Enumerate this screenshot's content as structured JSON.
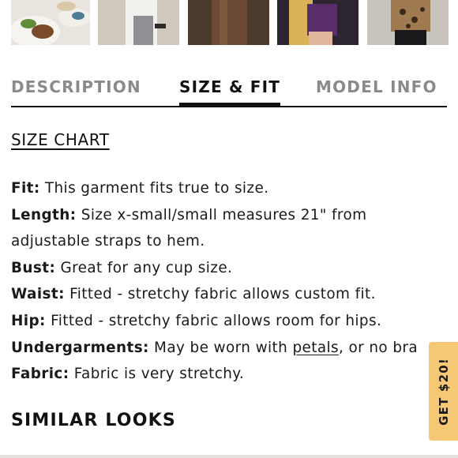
{
  "thumbnails": [
    {
      "name": "thumbnail-food-plate",
      "bg": "#e9e5de"
    },
    {
      "name": "thumbnail-model-white",
      "bg": "#d7d2cb"
    },
    {
      "name": "thumbnail-model-brown",
      "bg": "#5b4535"
    },
    {
      "name": "thumbnail-model-purple",
      "bg": "#3a2f3c"
    },
    {
      "name": "thumbnail-model-leopard",
      "bg": "#cfcac4"
    }
  ],
  "tabs": {
    "description": "DESCRIPTION",
    "size_fit": "SIZE & FIT",
    "model_info": "MODEL INFO",
    "active": "size_fit"
  },
  "size_chart_link": "SIZE CHART",
  "fit_details": {
    "fit": {
      "label": "Fit:",
      "text": " This garment fits true to size."
    },
    "length": {
      "label": "Length:",
      "text": " Size x-small/small measures 21\" from",
      "text2": "adjustable straps to hem."
    },
    "bust": {
      "label": "Bust:",
      "text": " Great for any cup size."
    },
    "waist": {
      "label": "Waist:",
      "text": " Fitted - stretchy fabric allows custom fit."
    },
    "hip": {
      "label": "Hip:",
      "text": " Fitted - stretchy fabric allows room for hips."
    },
    "undergarments": {
      "label": "Undergarments:",
      "text": " May be worn with ",
      "link": "petals",
      "text2": ", or no bra"
    },
    "fabric": {
      "label": "Fabric:",
      "text": " Fabric is very stretchy."
    }
  },
  "similar_looks_heading": "SIMILAR LOOKS",
  "promo": {
    "label": "GET $20!",
    "color": "#f7c873"
  }
}
